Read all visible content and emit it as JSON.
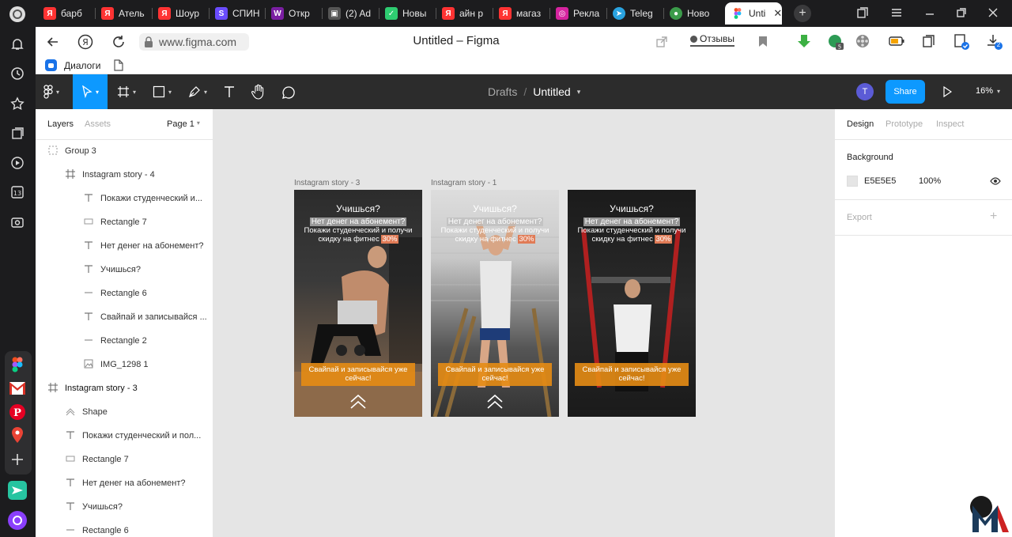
{
  "browser": {
    "tabs": [
      {
        "label": "барб",
        "fav": "Я",
        "color": "#f33"
      },
      {
        "label": "Атель",
        "fav": "Я",
        "color": "#f33"
      },
      {
        "label": "Шоур",
        "fav": "Я",
        "color": "#f33"
      },
      {
        "label": "СПИН",
        "fav": "S",
        "color": "#6a4cff"
      },
      {
        "label": "Откр",
        "fav": "W",
        "color": "#7b1fa2"
      },
      {
        "label": "(2) Ad",
        "fav": "▣",
        "color": "#666"
      },
      {
        "label": "Новы",
        "fav": "✓",
        "color": "#2ecc71"
      },
      {
        "label": "айн р",
        "fav": "Я",
        "color": "#f33"
      },
      {
        "label": "магаз",
        "fav": "Я",
        "color": "#f33"
      },
      {
        "label": "Рекла",
        "fav": "◎",
        "color": "#d6249f"
      },
      {
        "label": "Teleg",
        "fav": "➤",
        "color": "#2aa3e0"
      },
      {
        "label": "Ново",
        "fav": "●",
        "color": "#3b9b4a"
      },
      {
        "label": "Unti",
        "fav": "F",
        "color": "#f24e1e"
      }
    ],
    "url": "www.figma.com",
    "page_title": "Untitled – Figma",
    "reviews_label": "Отзывы",
    "bookmark_label": "Диалоги",
    "download_badge": "2"
  },
  "figma": {
    "breadcrumb_root": "Drafts",
    "breadcrumb_sep": "/",
    "file_name": "Untitled",
    "avatar_letter": "T",
    "share_label": "Share",
    "zoom": "16%",
    "left_tabs": {
      "layers": "Layers",
      "assets": "Assets",
      "page": "Page 1"
    },
    "layers": [
      {
        "name": "Group 3",
        "icon": "group",
        "indent": 1
      },
      {
        "name": "Instagram story - 4",
        "icon": "frame",
        "indent": 2
      },
      {
        "name": "Покажи студенческий и...",
        "icon": "text",
        "indent": 3
      },
      {
        "name": "Rectangle 7",
        "icon": "rect",
        "indent": 3
      },
      {
        "name": "Нет денег на абонемент?",
        "icon": "text",
        "indent": 3
      },
      {
        "name": "Учишься?",
        "icon": "text",
        "indent": 3
      },
      {
        "name": "Rectangle 6",
        "icon": "line",
        "indent": 3
      },
      {
        "name": "Свайпай и записывайся ...",
        "icon": "text",
        "indent": 3
      },
      {
        "name": "Rectangle 2",
        "icon": "line",
        "indent": 3
      },
      {
        "name": "IMG_1298 1",
        "icon": "image",
        "indent": 3
      },
      {
        "name": "Instagram story - 3",
        "icon": "frame",
        "indent": 1
      },
      {
        "name": "Shape",
        "icon": "shape",
        "indent": 2
      },
      {
        "name": "Покажи студенческий и пол...",
        "icon": "text",
        "indent": 2
      },
      {
        "name": "Rectangle 7",
        "icon": "rect",
        "indent": 2
      },
      {
        "name": "Нет денег на абонемент?",
        "icon": "text",
        "indent": 2
      },
      {
        "name": "Учишься?",
        "icon": "text",
        "indent": 2
      },
      {
        "name": "Rectangle 6",
        "icon": "line",
        "indent": 2
      }
    ],
    "right_tabs": {
      "design": "Design",
      "prototype": "Prototype",
      "inspect": "Inspect"
    },
    "background_label": "Background",
    "background_hex": "E5E5E5",
    "background_opacity": "100%",
    "export_label": "Export",
    "frames": [
      {
        "label": "Instagram story - 3"
      },
      {
        "label": "Instagram story - 1"
      },
      {
        "label": ""
      }
    ],
    "story": {
      "title": "Учишься?",
      "question": "Нет денег на абонемент?",
      "text_line1": "Покажи студенческий и получи",
      "text_line2": "скидку на фитнес",
      "percent": "30%",
      "cta_line1": "Свайпай и записывайся уже",
      "cta_line2": "сейчас!"
    }
  },
  "colors": {
    "accent": "#0d99ff",
    "canvas": "#e5e5e5",
    "toolbar": "#2c2c2c",
    "cta": "#e68c14"
  }
}
